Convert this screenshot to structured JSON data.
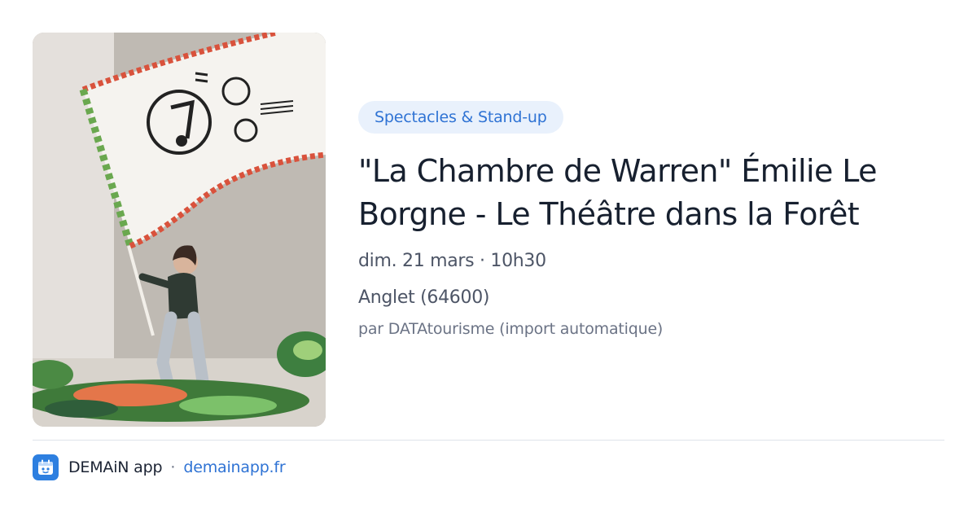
{
  "event": {
    "category": "Spectacles & Stand-up",
    "title": "\"La Chambre de Warren\" Émilie Le Borgne - Le Théâtre dans la Forêt",
    "datetime": "dim. 21 mars · 10h30",
    "location": "Anglet (64600)",
    "source": "par DATAtourisme (import automatique)",
    "image": "event-photo"
  },
  "footer": {
    "app_icon": "app-logo-icon",
    "app_name": "DEMAiN app",
    "separator": "·",
    "url": "demainapp.fr"
  },
  "colors": {
    "accent": "#2f73d4",
    "badge_bg": "#e9f1fc",
    "title": "#17202f",
    "meta": "#4d5566",
    "divider": "#dfe4ea"
  }
}
